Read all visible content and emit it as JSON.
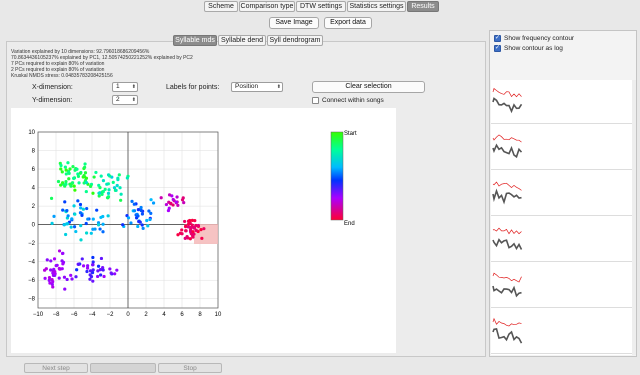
{
  "top_tabs": [
    "Scheme",
    "Comparison type",
    "DTW settings",
    "Statistics settings",
    "Results"
  ],
  "active_top_tab": "Results",
  "toolbar": {
    "save_image": "Save Image",
    "export_data": "Export data"
  },
  "sub_tabs": [
    "Syllable mds",
    "Syllable dend",
    "Syll dendrogram"
  ],
  "active_sub_tab": "Syllable mds",
  "info_lines": [
    "Variation explained by 10 dimensions: 92.796018686209456%",
    "70.8634436105237% explained by PC1, 12.50574250221252% explained by PC2",
    "7 PCs required to explain 80% of variation",
    "2 PCs required to explain 80% of variation",
    "Kruskal NMDS stress: 0.04835783208425156"
  ],
  "controls": {
    "x_label": "X-dimension:",
    "x_value": "1",
    "y_label": "Y-dimension:",
    "y_value": "2",
    "points_label": "Labels for points:",
    "points_value": "Position",
    "clear_selection": "Clear selection",
    "connect_label": "Connect within songs"
  },
  "right": {
    "show_freq": "Show frequency contour",
    "show_log": "Show contour as log"
  },
  "bottom": {
    "next_step": "Next step",
    "stop": "Stop"
  },
  "chart_data": {
    "type": "scatter",
    "x_ticks": [
      "−10",
      "−8",
      "−6",
      "−4",
      "−2",
      "0",
      "2",
      "4",
      "6",
      "8",
      "10"
    ],
    "y_ticks": [
      "10",
      "8",
      "6",
      "4",
      "2",
      "0",
      "−2",
      "−4",
      "−6",
      "−8"
    ],
    "xlim": [
      -10,
      10
    ],
    "ylim": [
      -9,
      10
    ],
    "colorbar_start": "Start",
    "colorbar_end": "End",
    "grid": true
  }
}
